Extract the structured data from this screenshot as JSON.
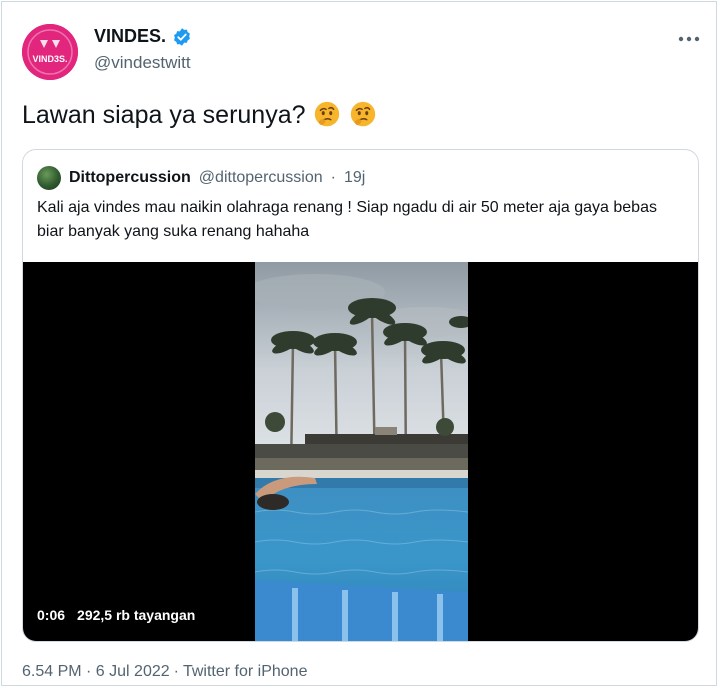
{
  "tweet": {
    "author": {
      "name": "VINDES.",
      "handle": "@vindestwitt",
      "avatar_label": "VIND3S.",
      "avatar_color": "#e2257d",
      "verified_color": "#1d9bf0"
    },
    "more_icon": "more-dots-icon",
    "text": "Lawan siapa ya serunya?",
    "emojis": [
      "thinking-face-icon",
      "thinking-face-icon"
    ],
    "timestamp": "6.54 PM · 6 Jul 2022",
    "separator": "·",
    "source": "Twitter for iPhone"
  },
  "quote": {
    "name": "Dittopercussion",
    "handle": "@dittopercussion",
    "separator": "·",
    "time": "19j",
    "text": "Kali aja vindes mau naikin olahraga renang ! Siap ngadu di air 50 meter aja gaya bebas biar banyak yang suka renang hahaha",
    "video": {
      "duration": "0:06",
      "views": "292,5 rb tayangan"
    }
  }
}
